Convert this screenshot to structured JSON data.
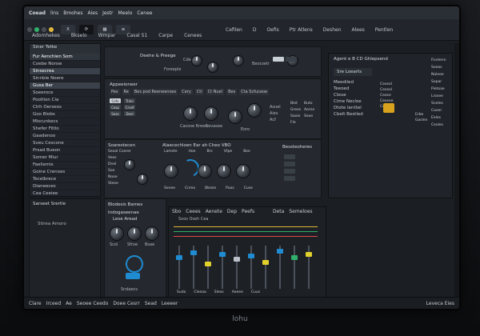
{
  "topbar": {
    "app": "Coead",
    "menu": [
      "lins",
      "Bmohes",
      "Aies",
      "Jestr",
      "Meelo",
      "Cenee"
    ]
  },
  "toolbar": {
    "left_tabs": [
      "Adomhekes",
      "Bkselo",
      "Wmpar",
      "Casal S1",
      "Carpe",
      "Cenees"
    ],
    "right_tabs": [
      "Cefilen",
      "D",
      "Oefis",
      "Ptr Atlens",
      "Deshen",
      "Alees",
      "Pentlen"
    ],
    "close_label": "X"
  },
  "left_panel": {
    "title": "Siner Tetke",
    "items": [
      "Fur Aenchien Som",
      "Coebe Nonse",
      "Sinsecrea",
      "Sinnbie Noere",
      "Gusa Ber",
      "Soeeroce",
      "Pooltion Cia",
      "Ctrh Oerseos",
      "Goo Biobs",
      "Miscunkecs",
      "Shefer Filtlo",
      "Gaadenoo",
      "Sveu Cescone",
      "Prsad Bueon",
      "Somer Miur",
      "Faeliemis",
      "Goine Crenoes",
      "Tecelbrece",
      "Dianeeces",
      "Cea Ceeiee"
    ]
  },
  "left_bottom": {
    "title": "Sarseet Srertle",
    "subtitle": "Stirea Amoro"
  },
  "panel_a": {
    "title": "Deehe & Preege",
    "sub1": "Cde",
    "sub2": "Foreeple",
    "sub3": "Beocsetr"
  },
  "panel_b": {
    "title": "Appeeioneer",
    "tabs": [
      "Pes",
      "Re",
      "Bes pod Reeneenoes",
      "Cery",
      "Ctl",
      "Ct Nuel",
      "Bes",
      "Cta Scfuceoe"
    ],
    "chips": [
      "Cofo",
      "Trolo",
      "Cosp",
      "Crvef",
      "Sese",
      "Deel"
    ],
    "knob_labels": [
      "Cacose Rreee",
      "Sevasee",
      "Eoro"
    ],
    "side": [
      "Asuel",
      "Aies",
      "Acf"
    ],
    "grid": [
      "Blet",
      "Buto",
      "Grees",
      "Aorne",
      "Saoie",
      "Seoe",
      "Fle"
    ]
  },
  "panel_c": {
    "title": "Soarestecen",
    "left_labels": [
      "Seoal Coerer",
      "Vees",
      "Dnel",
      "Soe",
      "Nooe",
      "Steoe"
    ],
    "center_title": "Alaecechloen Ear ah Cheo VBO",
    "center_row": [
      "Lamste",
      "Hoe",
      "Brs",
      "Vtpe",
      "Bee"
    ],
    "center_bottom": [
      "Senee",
      "Cnmo",
      "Btesie",
      "Puos",
      "Cuse"
    ],
    "right_title": "Bessteoheres"
  },
  "right_panel": {
    "title": "Agent e B CD Ghlepsend",
    "tag": "Sre Loearts",
    "items": [
      "Meediled",
      "Teeoed",
      "Cleue",
      "Cime Necloe",
      "Dtote Ienttel",
      "Cbelt Bestled"
    ],
    "right_items": [
      "Ceosol",
      "Ceosol",
      "Cease",
      "Ceosoe",
      "Coedo"
    ],
    "mini_labels": [
      "Erbe",
      "Gaslen"
    ],
    "sidebar_list": [
      "Ficelenn",
      "Soeas",
      "Naleoe",
      "Sopar",
      "Pietoae",
      "Lrosee",
      "Sneles",
      "Coeer",
      "Eeles",
      "Ceoles"
    ]
  },
  "lower_left": {
    "title": "Blodesis Bames",
    "sub": "Indogaseenae",
    "sub2": "Lese Aread",
    "labels": [
      "Scoi",
      "Sfroe",
      "Bsae"
    ],
    "bottom": "Sndaecs"
  },
  "mixer": {
    "tabs": [
      "Sbo",
      "Ceees",
      "Aenete",
      "Dep",
      "Peefs"
    ],
    "right_tab": "Deta",
    "right_tab2": "Semeloes",
    "row_label": "Soos Oseh Cea",
    "bottom": [
      "Sudo",
      "Cleeaa",
      "Sleos",
      "Aeeee",
      "Cuus"
    ]
  },
  "bottombar": {
    "items": [
      "Clare",
      "Irceed",
      "Ae",
      "Seoee Ceedo",
      "Doee Cesrr",
      "Sead",
      "Leeeer"
    ],
    "right": "Leveca Eies"
  },
  "brand": "lohu"
}
